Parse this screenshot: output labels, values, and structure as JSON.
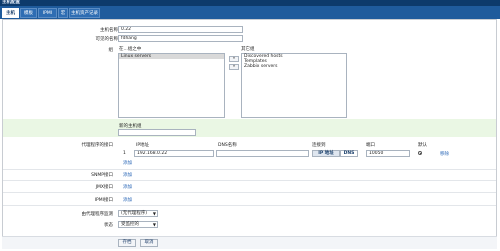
{
  "window": {
    "title": "主机配置"
  },
  "tabs": [
    {
      "label": "主机",
      "active": true
    },
    {
      "label": "模板",
      "active": false
    },
    {
      "label": "IPMI",
      "active": false
    },
    {
      "label": "宏",
      "active": false
    },
    {
      "label": "主机资产记录",
      "active": false
    }
  ],
  "form": {
    "hostname_label": "主机名称",
    "hostname_value": "0.22",
    "visible_name_label": "可见的名称",
    "visible_name_value": "fdhang",
    "groups_label": "组",
    "in_groups_label": "在...组之中",
    "other_groups_label": "其它组",
    "in_groups": [
      "Linux servers"
    ],
    "other_groups": [
      "Discovered hosts",
      "Templates",
      "Zabbix servers"
    ],
    "move_left": "«",
    "move_right": "»",
    "new_group_label": "新的主机组",
    "new_group_value": "",
    "agent_interfaces_label": "代理程序的接口",
    "iface_headers": {
      "ip": "IP地址",
      "dns": "DNS名称",
      "connect": "连接到",
      "port": "端口",
      "default": "默认"
    },
    "iface_row": {
      "index": "1",
      "ip": "192.168.0.22",
      "dns": "",
      "connect_ip": "IP 地址",
      "connect_dns": "DNS",
      "port": "10050",
      "remove": "移除"
    },
    "add_label": "添加",
    "snmp_label": "SNMP接口",
    "jmx_label": "JMX接口",
    "ipmi_label": "IPMI接口",
    "proxy_label": "由代理程序监测",
    "proxy_value": "(无代理程序)",
    "status_label": "状态",
    "status_value": "受监控的"
  },
  "actions": {
    "save": "存档",
    "cancel": "取消"
  },
  "colors": {
    "tabbar": "#1f5b9c",
    "titlebar": "#0d3a6b",
    "highlight": "#eaf7e4",
    "link": "#1f5fb3"
  }
}
